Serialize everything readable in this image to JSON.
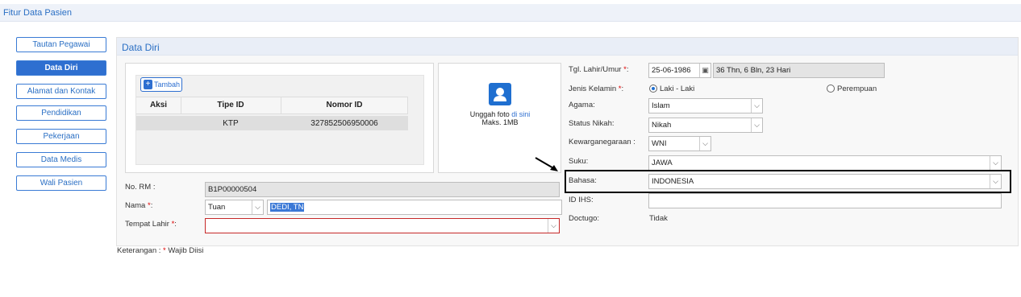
{
  "page_title": "Fitur Data Pasien",
  "nav": [
    {
      "label": "Tautan Pegawai",
      "active": false
    },
    {
      "label": "Data Diri",
      "active": true
    },
    {
      "label": "Alamat dan Kontak",
      "active": false
    },
    {
      "label": "Pendidikan",
      "active": false
    },
    {
      "label": "Pekerjaan",
      "active": false
    },
    {
      "label": "Data Medis",
      "active": false
    },
    {
      "label": "Wali Pasien",
      "active": false
    }
  ],
  "section_title": "Data Diri",
  "id_table": {
    "add_label": "Tambah",
    "headers": [
      "Aksi",
      "Tipe ID",
      "Nomor ID"
    ],
    "rows": [
      [
        "",
        "KTP",
        "327852506950006"
      ]
    ]
  },
  "photo": {
    "text": "Unggah foto",
    "link": "di sini",
    "limit": "Maks. 1MB"
  },
  "left_form": {
    "no_rm_label": "No. RM :",
    "no_rm_value": "B1P00000504",
    "nama_label": "Nama",
    "nama_title": "Tuan",
    "nama_value": "DEDI, TN",
    "tempat_lahir_label": "Tempat Lahir",
    "tempat_lahir_value": ""
  },
  "right_form": {
    "tgl_label": "Tgl. Lahir/Umur",
    "tgl_value": "25-06-1986",
    "umur_value": "36 Thn, 6 Bln, 23 Hari",
    "jk_label": "Jenis Kelamin",
    "jk_options": [
      "Laki - Laki",
      "Perempuan"
    ],
    "agama_label": "Agama:",
    "agama_value": "Islam",
    "status_label": "Status Nikah:",
    "status_value": "Nikah",
    "kwn_label": "Kewarganegaraan :",
    "kwn_value": "WNI",
    "suku_label": "Suku:",
    "suku_value": "JAWA",
    "bahasa_label": "Bahasa:",
    "bahasa_value": "INDONESIA",
    "ihs_label": "ID IHS:",
    "ihs_value": "",
    "doctugo_label": "Doctugo:",
    "doctugo_value": "Tidak"
  },
  "required_mark": "*",
  "required_suffix": ":",
  "footnote_prefix": "Keterangan : ",
  "footnote_suffix": "Wajib Diisi"
}
